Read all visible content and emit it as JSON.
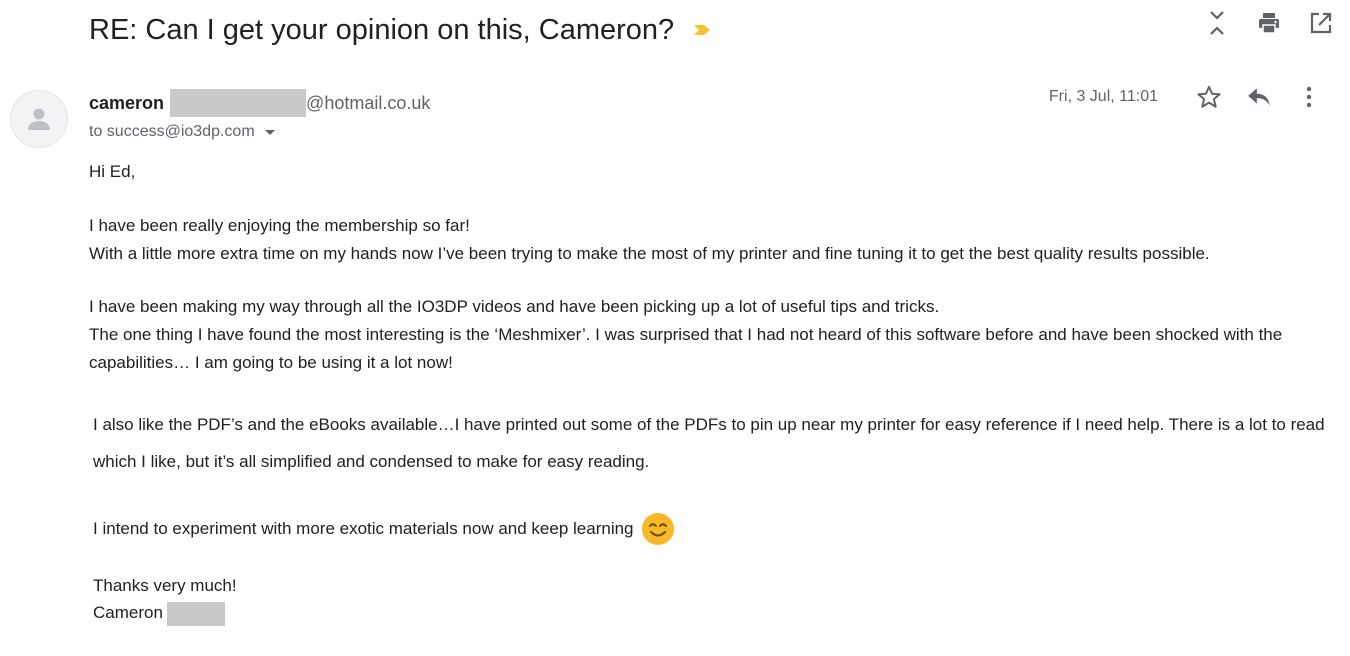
{
  "subject": "RE: Can I get your opinion on this, Cameron?",
  "sender": {
    "name": "cameron",
    "email_domain": "@hotmail.co.uk",
    "to_line": "to success@io3dp.com"
  },
  "date": "Fri, 3 Jul, 11:01",
  "body": {
    "greeting": "Hi Ed,",
    "p1": [
      "I have been really enjoying the membership so far!",
      "With a little more extra time on my hands now I’ve been trying to make the most of my printer and fine tuning it to get the best quality results possible."
    ],
    "p2": [
      "I have been making my way through all the IO3DP videos and have been picking up a lot of useful tips and tricks.",
      "The one thing I have found the most interesting is the ‘Meshmixer’. I was surprised that I had not heard of this software before and have been shocked with the capabilities… I am going to be using it a lot now!"
    ],
    "p3": "I also like the PDF’s and the eBooks available…I have printed out some of the PDFs to pin up near my printer for easy reference if I need help. There is a lot to read which I like, but it’s all simplified and condensed to make for easy reading.",
    "p4": "I intend to experiment with more exotic materials now and keep learning",
    "sign_off": "Thanks very much!",
    "signature": "Cameron"
  },
  "icons": {
    "importance": "importance-marker-icon",
    "collapse": "collapse-all-icon",
    "print": "print-icon",
    "new_window": "open-in-new-window-icon",
    "star": "star-icon",
    "reply": "reply-icon",
    "more": "more-vert-icon",
    "avatar": "default-avatar-icon",
    "emoji": "smiling-face-icon"
  },
  "colors": {
    "importance": "#f4c430",
    "secondary_text": "#5f6368",
    "redaction": "#c9c9c9",
    "emoji": "#f7b928"
  }
}
